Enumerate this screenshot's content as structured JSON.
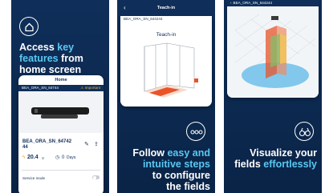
{
  "panel1": {
    "headline": {
      "line1_a": "Access ",
      "line1_accent": "key",
      "line2_accent": "features",
      "line2_b": " from",
      "line3": "home screen"
    },
    "phone": {
      "title": "Home",
      "device_bar": "BEA_ORA_SN_64744",
      "device_bar_right": "⚠ Important",
      "device_name_1": "BEA_ORA_SN_64742",
      "device_name_2": "44",
      "voltage": "20.4",
      "voltage_unit": "V",
      "days": "0",
      "days_unit": "Days",
      "service_mode": "Service mode"
    }
  },
  "panel2": {
    "phone": {
      "nav_title": "Teach-in",
      "device_bar": "BEA_ORA_SN_644244",
      "screen_title": "Teach-in"
    },
    "headline": {
      "line1_a": "Follow ",
      "line1_accent": "easy and",
      "line2_accent": "intuitive steps",
      "line3": "to configure",
      "line4": "the fields"
    }
  },
  "panel3": {
    "phone": {
      "device_bar": "BEA_ORA_SN_644244"
    },
    "headline": {
      "line1": "Visualize your",
      "line2_a": "fields ",
      "line2_accent": "effortlessly"
    }
  },
  "colors": {
    "navy": "#0f2f5a",
    "accent": "#59c8f2",
    "orange": "#e8542a",
    "sky": "#5cb8e8"
  }
}
